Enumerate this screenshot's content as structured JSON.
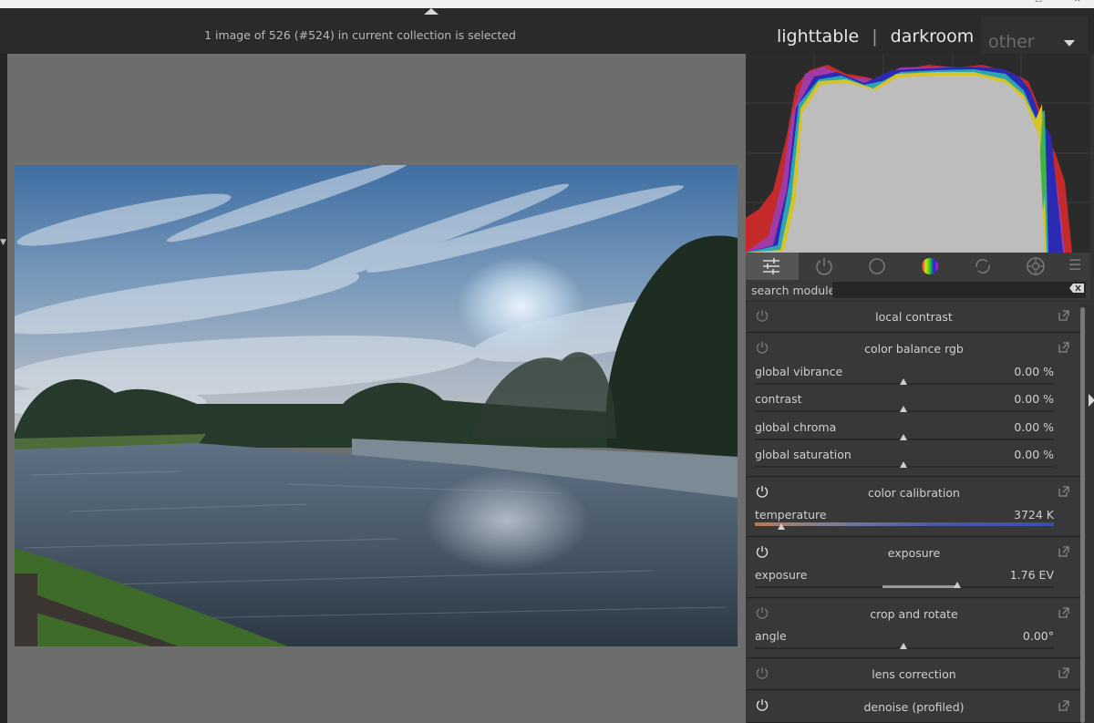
{
  "header": {
    "status": "1 image of 526 (#524) in current collection is selected",
    "views": [
      "lighttable",
      "darkroom"
    ],
    "other_label": "other"
  },
  "search": {
    "label": "search module"
  },
  "modules": {
    "local_contrast": {
      "title": "local contrast"
    },
    "color_balance": {
      "title": "color balance rgb",
      "params": [
        {
          "name": "global vibrance",
          "value": "0.00 %"
        },
        {
          "name": "contrast",
          "value": "0.00 %"
        },
        {
          "name": "global chroma",
          "value": "0.00 %"
        },
        {
          "name": "global saturation",
          "value": "0.00 %"
        }
      ]
    },
    "color_calibration": {
      "title": "color calibration",
      "param": {
        "name": "temperature",
        "value": "3724 K"
      }
    },
    "exposure": {
      "title": "exposure",
      "param": {
        "name": "exposure",
        "value": "1.76 EV"
      }
    },
    "crop": {
      "title": "crop and rotate",
      "param": {
        "name": "angle",
        "value": "0.00°"
      }
    },
    "lens": {
      "title": "lens correction"
    },
    "denoise": {
      "title": "denoise (profiled)"
    }
  },
  "icons": [
    "quick-access-icon",
    "power-icon",
    "circle-icon",
    "color-wheel-icon",
    "correct-icon",
    "effects-icon",
    "menu-icon"
  ],
  "colors": {
    "panel": "#333333",
    "center": "#6d6d6d",
    "histogram_fill": "#bdbdbd"
  }
}
